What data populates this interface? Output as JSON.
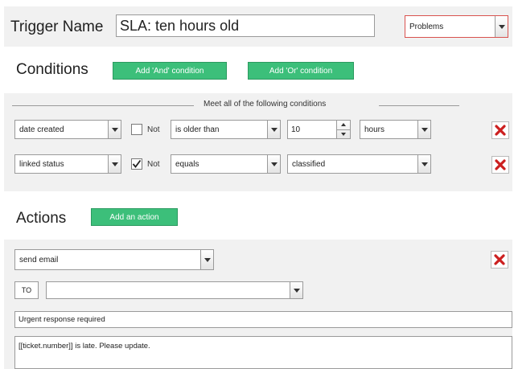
{
  "trigger": {
    "name_label": "Trigger Name",
    "name_value": "SLA: ten hours old",
    "category_value": "Problems"
  },
  "conditions": {
    "title": "Conditions",
    "add_and_label": "Add 'And' condition",
    "add_or_label": "Add 'Or' condition",
    "match_text": "Meet all of the following conditions",
    "rows": [
      {
        "field": "date created",
        "not_label": "Not",
        "not_checked": false,
        "operator": "is older than",
        "value": "10",
        "unit": "hours"
      },
      {
        "field": "linked status",
        "not_label": "Not",
        "not_checked": true,
        "operator": "equals",
        "value": "classified"
      }
    ]
  },
  "actions": {
    "title": "Actions",
    "add_label": "Add an action",
    "action_type": "send email",
    "to_label": "TO",
    "to_value": "",
    "subject": "Urgent response required",
    "body": "[[ticket.number]] is late.  Please update."
  },
  "colors": {
    "accent_green": "#3cbf7a",
    "delete_red": "#cc1f1f",
    "category_border": "#d9534f"
  },
  "icons": {
    "delete": "close-x-icon",
    "dropdown": "chevron-down-icon"
  }
}
